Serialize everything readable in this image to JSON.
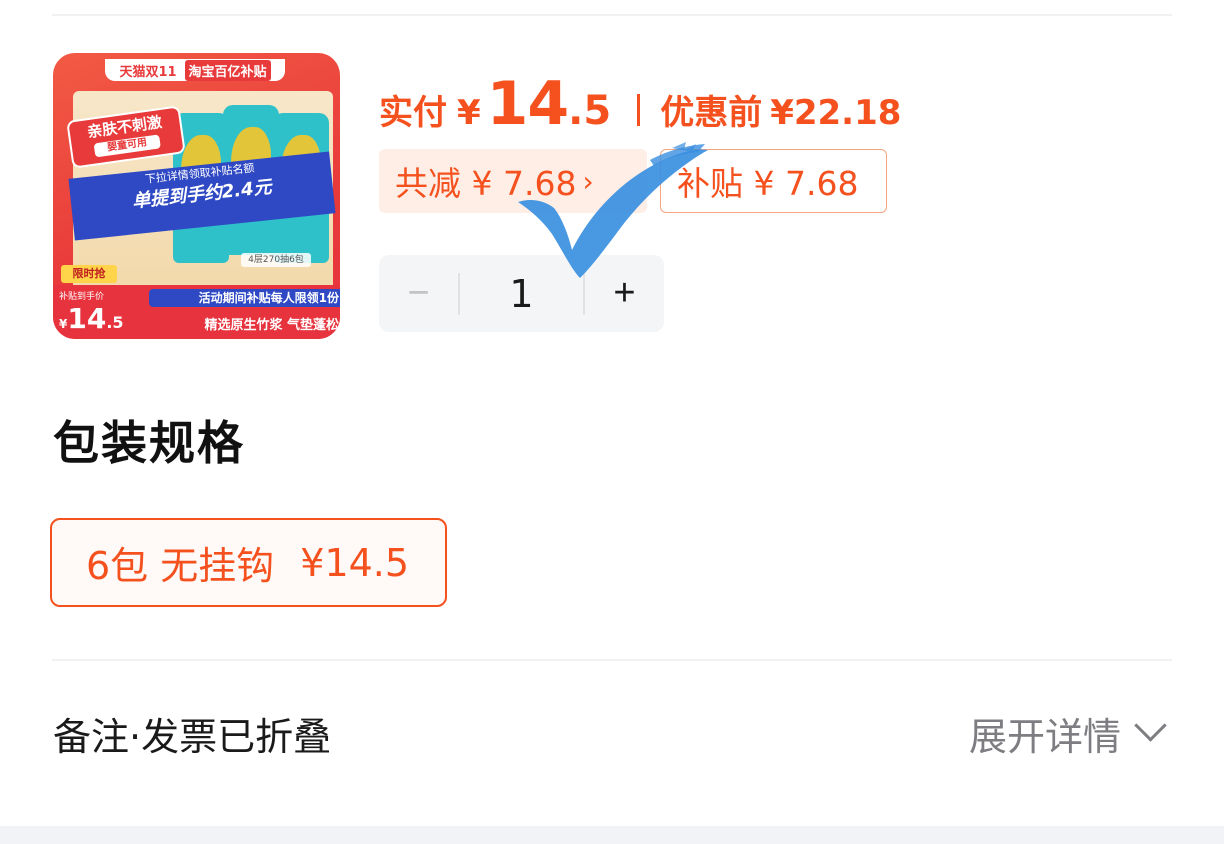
{
  "product_image": {
    "top_band_left": "天猫双11",
    "top_band_right": "淘宝百亿补贴",
    "badge_main": "亲肤不刺激",
    "badge_sub": "婴童可用",
    "banner_small": "下拉详情领取补贴名额",
    "banner_big": "单提到手约2.4元",
    "limited_tag": "限时抢",
    "spec_tag": "4层270抽6包",
    "price_label": "补贴到手价",
    "price_currency": "¥",
    "price_int": "14",
    "price_dec": ".5",
    "line1": "活动期间补贴每人限领1份",
    "line2": "精选原生竹浆 气垫蓬松"
  },
  "price": {
    "label": "实付",
    "currency": "¥",
    "int": "14",
    "dec": ".5",
    "orig_label": "优惠前",
    "orig_value": "¥22.18"
  },
  "discount": {
    "reduce_text": "共减 ¥ 7.68",
    "reduce_arrow": "›",
    "subsidy_text": "补贴 ¥ 7.68"
  },
  "quantity": {
    "minus": "−",
    "value": "1",
    "plus": "+"
  },
  "packaging": {
    "title": "包装规格",
    "selected_name": "6包 无挂钩",
    "selected_price": "¥14.5"
  },
  "footer": {
    "remark": "备注·发票已折叠",
    "expand": "展开详情"
  },
  "colors": {
    "accent": "#f5511e",
    "check_blue": "#3a8fe0"
  }
}
